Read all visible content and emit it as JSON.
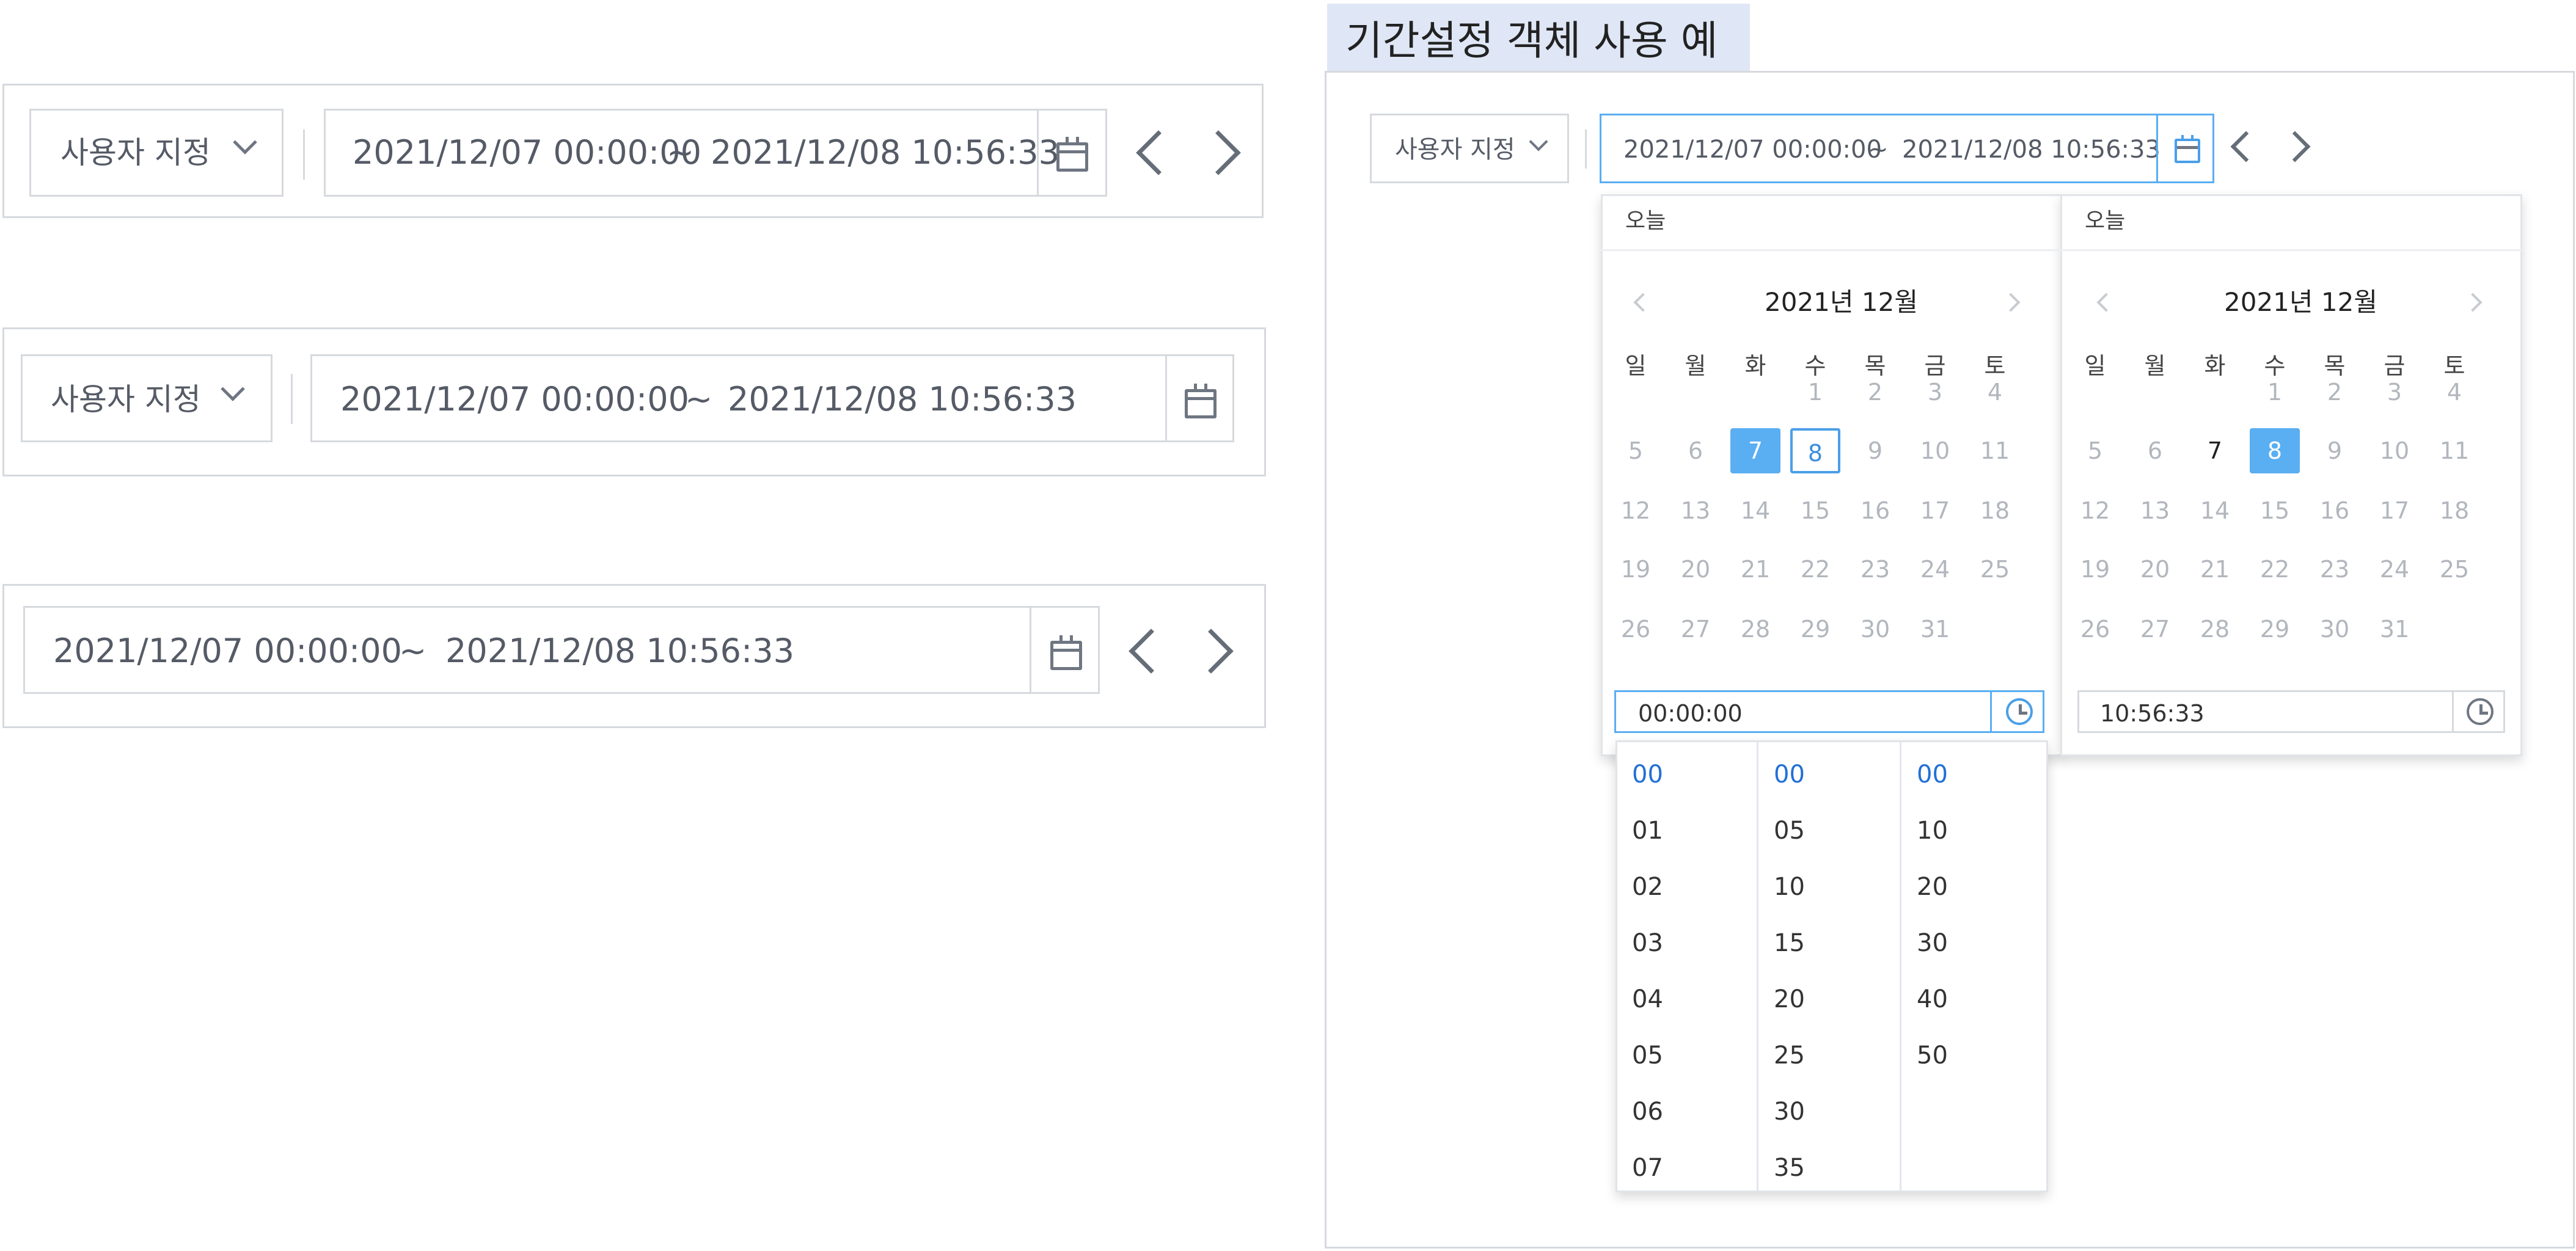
{
  "section_title": "기간설정 객체 사용 예",
  "variant_a": {
    "preset_label": "사용자 지정",
    "start": "2021/12/07 00:00:00",
    "tilde": "~",
    "end": "2021/12/08 10:56:33"
  },
  "variant_b": {
    "preset_label": "사용자 지정",
    "start": "2021/12/07 00:00:00",
    "tilde": "~",
    "end": "2021/12/08 10:56:33"
  },
  "variant_c": {
    "start": "2021/12/07 00:00:00",
    "tilde": "~",
    "end": "2021/12/08 10:56:33"
  },
  "example": {
    "preset_label": "사용자 지정",
    "start": "2021/12/07 00:00:00",
    "tilde": "~",
    "end": "2021/12/08 10:56:33",
    "left_calendar": {
      "today_label": "오늘",
      "month_label": "2021년 12월",
      "time_value": "00:00:00"
    },
    "right_calendar": {
      "today_label": "오늘",
      "month_label": "2021년 12월",
      "time_value": "10:56:33"
    },
    "weekdays": [
      "일",
      "월",
      "화",
      "수",
      "목",
      "금",
      "토"
    ],
    "month_grid": [
      [
        "",
        "",
        "",
        "1",
        "2",
        "3",
        "4"
      ],
      [
        "5",
        "6",
        "7",
        "8",
        "9",
        "10",
        "11"
      ],
      [
        "12",
        "13",
        "14",
        "15",
        "16",
        "17",
        "18"
      ],
      [
        "19",
        "20",
        "21",
        "22",
        "23",
        "24",
        "25"
      ],
      [
        "26",
        "27",
        "28",
        "29",
        "30",
        "31",
        ""
      ]
    ],
    "left_selected_day": "7",
    "left_range_end_day": "8",
    "right_selected_day": "8",
    "right_current_day": "7",
    "time_picker": {
      "hours": [
        "00",
        "01",
        "02",
        "03",
        "04",
        "05",
        "06",
        "07"
      ],
      "minutes": [
        "00",
        "05",
        "10",
        "15",
        "20",
        "25",
        "30",
        "35"
      ],
      "seconds": [
        "00",
        "10",
        "20",
        "30",
        "40",
        "50"
      ],
      "selected_hour": "00",
      "selected_minute": "00",
      "selected_second": "00"
    }
  },
  "colors": {
    "accent": "#5aaef2",
    "accent_text": "#2270d6",
    "border": "#d6d9de",
    "title_bg": "#dfe6f5"
  }
}
